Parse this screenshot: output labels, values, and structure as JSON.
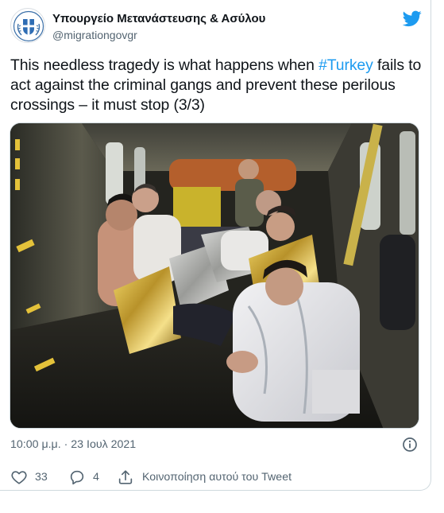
{
  "account": {
    "display_name": "Υπουργείο Μετανάστευσης & Ασύλου",
    "handle": "@migrationgovgr",
    "avatar_icon": "greek-coat-of-arms-icon"
  },
  "tweet": {
    "text_before": "This needless tragedy is what happens when ",
    "hashtag": "#Turkey",
    "text_after": " fails to act against the criminal gangs and prevent these perilous crossings – it must stop (3/3)"
  },
  "media": {
    "icon": "photo-helicopter-cabin"
  },
  "meta": {
    "timestamp": "10:00 μ.μ. · 23 Ιουλ 2021",
    "info_icon": "info-icon"
  },
  "actions": {
    "likes": "33",
    "replies": "4",
    "share_label": "Κοινοποίηση αυτού του Tweet"
  },
  "colors": {
    "accent": "#1d9bf0",
    "text": "#0f1419",
    "secondary": "#536471",
    "border": "#cfd9de"
  },
  "icons": {
    "platform": "twitter-bird-icon",
    "like": "heart-icon",
    "reply": "speech-bubble-icon",
    "share": "share-upload-icon"
  }
}
